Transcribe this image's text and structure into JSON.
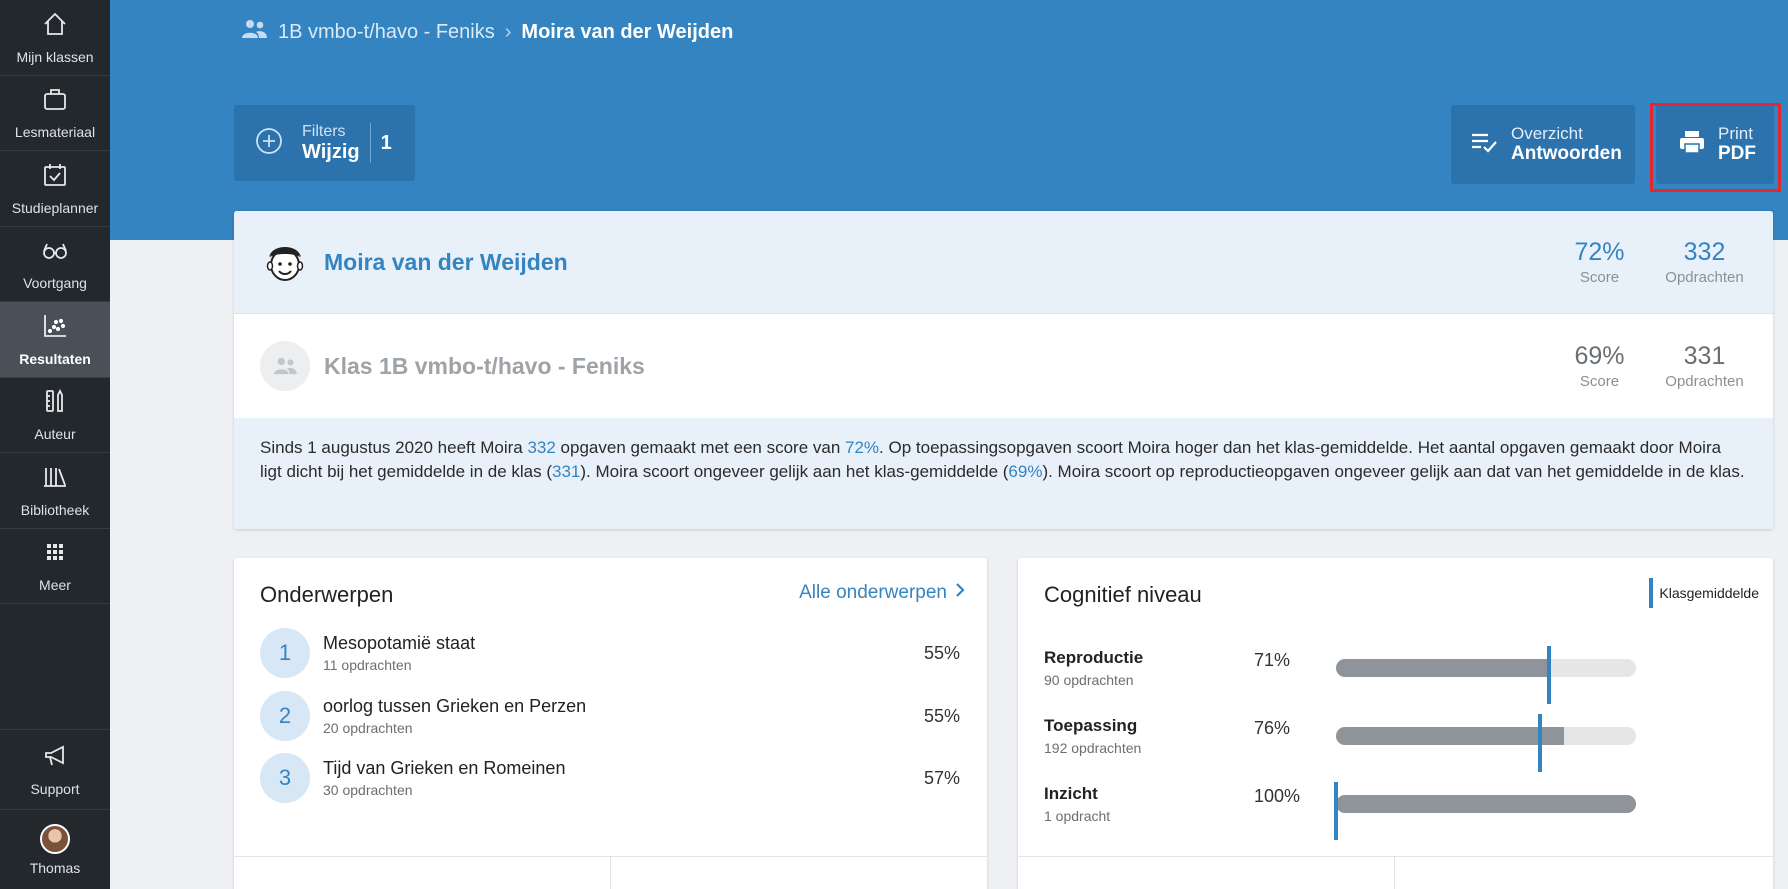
{
  "sidebar": {
    "items": [
      {
        "label": "Mijn klassen",
        "icon": "home-icon"
      },
      {
        "label": "Lesmateriaal",
        "icon": "briefcase-icon"
      },
      {
        "label": "Studieplanner",
        "icon": "calendar-check-icon"
      },
      {
        "label": "Voortgang",
        "icon": "glasses-icon"
      },
      {
        "label": "Resultaten",
        "icon": "scatter-chart-icon"
      },
      {
        "label": "Auteur",
        "icon": "pencil-ruler-icon"
      },
      {
        "label": "Bibliotheek",
        "icon": "books-icon"
      },
      {
        "label": "Meer",
        "icon": "grid-icon"
      }
    ],
    "support_label": "Support",
    "user_name": "Thomas"
  },
  "breadcrumb": {
    "class_name": "1B vmbo-t/havo - Feniks",
    "student_name": "Moira van der Weijden"
  },
  "filters": {
    "label": "Filters",
    "action": "Wijzig",
    "count": "1"
  },
  "overview_button": {
    "line1": "Overzicht",
    "line2": "Antwoorden"
  },
  "print_button": {
    "line1": "Print",
    "line2": "PDF"
  },
  "student": {
    "name": "Moira van der Weijden",
    "score": "72%",
    "score_label": "Score",
    "assignments": "332",
    "assignments_label": "Opdrachten"
  },
  "class": {
    "name": "Klas 1B vmbo-t/havo - Feniks",
    "score": "69%",
    "score_label": "Score",
    "assignments": "331",
    "assignments_label": "Opdrachten"
  },
  "summary": {
    "p1": "Sinds 1 augustus 2020 heeft Moira ",
    "h1": "332",
    "p2": " opgaven gemaakt met een score van ",
    "h2": "72%",
    "p3": ". Op toepassingsopgaven scoort Moira hoger dan het klas-gemiddelde. Het aantal opgaven gemaakt door Moira ligt dicht bij het gemiddelde in de klas (",
    "h3": "331",
    "p4": "). Moira scoort ongeveer gelijk aan het klas-gemiddelde (",
    "h4": "69%",
    "p5": "). Moira scoort op reproductieopgaven ongeveer gelijk aan dat van het gemiddelde in de klas."
  },
  "topics": {
    "title": "Onderwerpen",
    "all_link": "Alle onderwerpen",
    "items": [
      {
        "num": "1",
        "name": "Mesopotamië staat",
        "sub": "11 opdrachten",
        "pct": "55%"
      },
      {
        "num": "2",
        "name": "oorlog tussen Grieken en Perzen",
        "sub": "20 opdrachten",
        "pct": "55%"
      },
      {
        "num": "3",
        "name": "Tijd van Grieken en Romeinen",
        "sub": "30 opdrachten",
        "pct": "57%"
      }
    ]
  },
  "cognitive": {
    "title": "Cognitief niveau",
    "legend": "Klasgemiddelde",
    "rows": [
      {
        "name": "Reproductie",
        "sub": "90 opdrachten",
        "pct": "71%",
        "value": 0.71,
        "class_avg": 0.71
      },
      {
        "name": "Toepassing",
        "sub": "192 opdrachten",
        "pct": "76%",
        "value": 0.76,
        "class_avg": 0.68
      },
      {
        "name": "Inzicht",
        "sub": "1 opdracht",
        "pct": "100%",
        "value": 1.0,
        "class_avg": 0.0
      }
    ]
  }
}
